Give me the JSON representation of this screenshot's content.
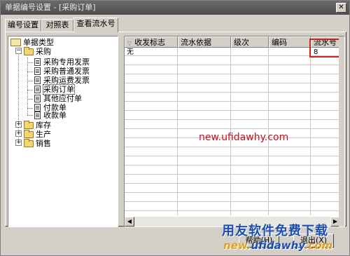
{
  "window": {
    "title": "单据编号设置 - [采购订单]",
    "close_symbol": "✕"
  },
  "tabs": [
    {
      "label": "编号设置"
    },
    {
      "label": "对照表"
    },
    {
      "label": "查看流水号",
      "active": true
    }
  ],
  "tree": {
    "root": "单据类型",
    "groups": [
      {
        "label": "采购",
        "expanded": true,
        "items": [
          "采购专用发票",
          "采购普通发票",
          "采购运费发票",
          "采购订单",
          "其他应付单",
          "付款单",
          "收款单"
        ],
        "selected": "采购订单"
      },
      {
        "label": "库存",
        "expanded": false
      },
      {
        "label": "生产",
        "expanded": false
      },
      {
        "label": "销售",
        "expanded": false
      }
    ],
    "expand_symbol": "+",
    "collapse_symbol": "−"
  },
  "grid": {
    "sort_indicator": "▽",
    "columns": [
      "收发标志",
      "流水依据",
      "级次",
      "编码",
      "流水号"
    ],
    "rows": [
      {
        "flag": "无",
        "basis": "",
        "level": "",
        "code": "",
        "serial": "8"
      }
    ],
    "highlight_column": "流水号",
    "highlight_color": "#d42020"
  },
  "scrollbar": {
    "left_arrow": "◀",
    "right_arrow": "▶"
  },
  "watermark": "new.ufidawhy.com",
  "brand": {
    "name": "用友软件免费下载",
    "url_a": "new.",
    "url_b": "ufidawhy",
    "url_c": ".com"
  },
  "buttons": {
    "help": "帮助(H)",
    "exit": "退出(X)"
  },
  "colors": {
    "window_bg": "#d4d0c8",
    "watermark": "#c0101c",
    "brand_blue": "#1c4fb0",
    "brand_orange": "#e0a020"
  }
}
